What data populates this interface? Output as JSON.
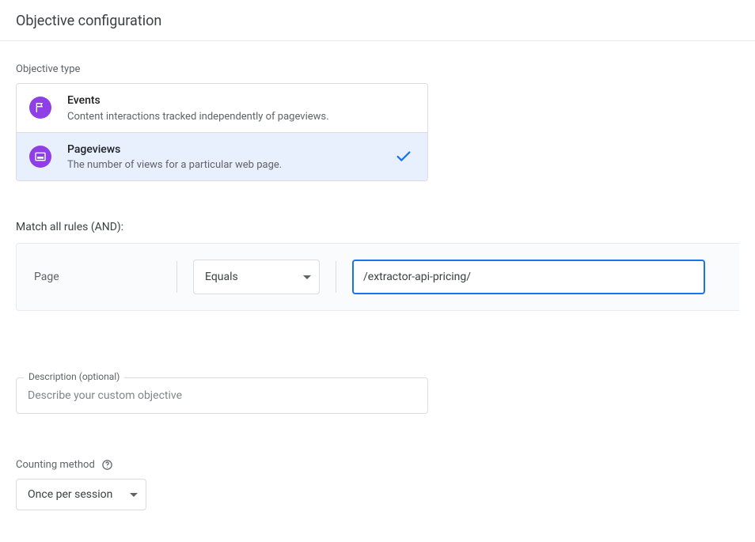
{
  "header": {
    "title": "Objective configuration"
  },
  "objectiveType": {
    "label": "Objective type",
    "options": [
      {
        "id": "events",
        "title": "Events",
        "subtitle": "Content interactions tracked independently of pageviews.",
        "selected": false
      },
      {
        "id": "pageviews",
        "title": "Pageviews",
        "subtitle": "The number of views for a particular web page.",
        "selected": true
      }
    ]
  },
  "rules": {
    "label": "Match all rules (AND):",
    "field": "Page",
    "operator": "Equals",
    "value": "/extractor-api-pricing/"
  },
  "description": {
    "floatingLabel": "Description (optional)",
    "placeholder": "Describe your custom objective",
    "value": ""
  },
  "counting": {
    "label": "Counting method",
    "value": "Once per session"
  }
}
